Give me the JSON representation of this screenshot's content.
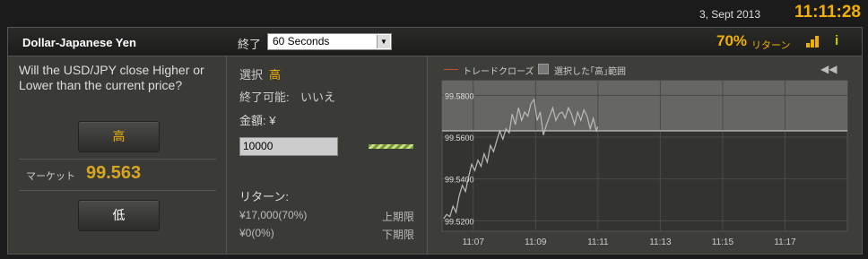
{
  "topbar": {
    "date": "3, Sept 2013",
    "time": "11:11:28"
  },
  "header": {
    "asset": "Dollar-Japanese Yen",
    "expiry_label": "終了",
    "expiry_value": "60 Seconds",
    "payout_percent": "70%",
    "payout_label": "リターン"
  },
  "left": {
    "question": "Will the USD/JPY close Higher or Lower than the current price?",
    "high_button": "高",
    "market_label": "マーケット",
    "market_value": "99.563",
    "low_button": "低"
  },
  "middle": {
    "selection_label": "選択",
    "selection_value": "高",
    "close_label": "終了可能:",
    "close_value": "いいえ",
    "amount_label": "金額: ¥",
    "amount_value": "10000",
    "return_label": "リターン:",
    "return_high_amount": "¥17,000(70%)",
    "return_high_label": "上期限",
    "return_low_amount": "¥0(0%)",
    "return_low_label": "下期限"
  },
  "chart": {
    "legend_trade": "トレードクローズ",
    "legend_range": "選択した｢高｣範囲",
    "colors": {
      "line": "#bbbbbb",
      "threshold": "#dddddd",
      "highlight": "#666663"
    }
  },
  "chart_data": {
    "type": "line",
    "x_ticks": [
      "11:07",
      "11:09",
      "11:11",
      "11:13",
      "11:15",
      "11:17"
    ],
    "y_ticks": [
      "99.5800",
      "99.5600",
      "99.5400",
      "99.5200"
    ],
    "ylim": [
      99.515,
      99.587
    ],
    "xlim_minutes": [
      6.0,
      19.0
    ],
    "reference_price": 99.563,
    "series": [
      {
        "x": [
          6.05,
          6.15,
          6.25,
          6.35,
          6.45,
          6.55,
          6.65,
          6.75,
          6.85,
          6.95,
          7.05,
          7.15,
          7.25,
          7.35,
          7.45,
          7.55,
          7.65,
          7.75,
          7.85,
          7.95,
          8.05,
          8.15,
          8.25,
          8.35,
          8.45,
          8.55,
          8.65,
          8.75,
          8.85,
          8.95,
          9.05,
          9.15,
          9.25,
          9.35,
          9.45,
          9.55,
          9.65,
          9.75,
          9.85,
          9.95,
          10.05,
          10.15,
          10.25,
          10.35,
          10.45,
          10.55,
          10.65,
          10.75,
          10.85,
          10.95,
          11.0
        ],
        "y": [
          99.521,
          99.523,
          99.522,
          99.527,
          99.524,
          99.532,
          99.537,
          99.534,
          99.541,
          99.547,
          99.544,
          99.549,
          99.546,
          99.552,
          99.548,
          99.556,
          99.553,
          99.558,
          99.563,
          99.559,
          99.564,
          99.562,
          99.571,
          99.566,
          99.574,
          99.568,
          99.572,
          99.57,
          99.576,
          99.578,
          99.568,
          99.572,
          99.561,
          99.566,
          99.57,
          99.574,
          99.568,
          99.571,
          99.572,
          99.569,
          99.574,
          99.571,
          99.566,
          99.572,
          99.568,
          99.573,
          99.57,
          99.564,
          99.569,
          99.563,
          99.565
        ]
      }
    ]
  }
}
